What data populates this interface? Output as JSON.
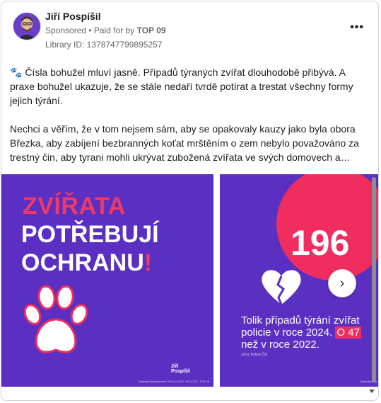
{
  "post": {
    "author": "Jiří Pospíšil",
    "sponsored": "Sponsored",
    "paid_for_prefix": " • Paid for by ",
    "paid_for_by": "TOP 09",
    "library_id": "Library ID: 1378747799895257",
    "paragraph1": "🐾 Čísla bohužel mluví jasně. Případů týraných zvířat dlouhodobě přibývá. A praxe bohužel ukazuje, že se stále nedaří tvrdě potírat a trestat všechny formy jejich týrání.",
    "paragraph2": "Nechci a věřím, že v tom nejsem sám, aby se opakovaly kauzy jako byla obora Březka, aby zabíjení bezbranných koťat mrštěním o zem nebylo považováno za trestný čin, aby tyrani mohli ukrývat zubožená zvířata ve svých domovech a bránit..."
  },
  "slide1": {
    "line1": "ZVÍŘATA",
    "line2": "POTŘEBUJÍ",
    "line3": "OCHRANU",
    "bang": "!",
    "logo_line1": "Jiří",
    "logo_line2": "Pospíšil",
    "small_print": "Zadavatel/Zpracovatel: SPOLU 2022, KDU-ČSL, TOP 09"
  },
  "slide2": {
    "number": "196",
    "text_main": "Tolik případů týrání zvířat policie v roce 2024.",
    "highlight": "O 47",
    "text_tail": "než v roce 2022.",
    "source": "zdroj: Policie ČR",
    "small_print": "Zadavatel/Zpr"
  },
  "icons": {
    "more": "more-dots-icon",
    "next": "chevron-right-icon"
  },
  "colors": {
    "brand_purple": "#5a2fc2",
    "brand_pink": "#f02d5f"
  }
}
